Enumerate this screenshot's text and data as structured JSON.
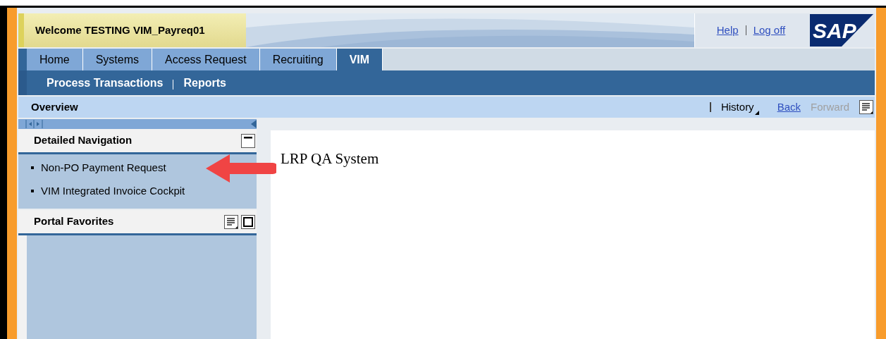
{
  "header": {
    "welcome": "Welcome TESTING VIM_Payreq01",
    "links": [
      "Help",
      "Log off"
    ],
    "logo": "SAP"
  },
  "tabs": [
    {
      "label": "Home",
      "selected": false
    },
    {
      "label": "Systems",
      "selected": false
    },
    {
      "label": "Access Request",
      "selected": false
    },
    {
      "label": "Recruiting",
      "selected": false
    },
    {
      "label": "VIM",
      "selected": true
    }
  ],
  "subnav": [
    "Process Transactions",
    "Reports"
  ],
  "toolbar": {
    "title": "Overview",
    "history": "History",
    "links": [
      {
        "label": "Back",
        "disabled": false
      },
      {
        "label": "Forward",
        "disabled": true
      }
    ]
  },
  "detailed_navigation": {
    "title": "Detailed Navigation",
    "items": [
      "Non-PO Payment Request",
      "VIM Integrated Invoice Cockpit"
    ]
  },
  "portal_favorites": {
    "title": "Portal Favorites"
  },
  "content": {
    "text": "LRP QA System"
  }
}
